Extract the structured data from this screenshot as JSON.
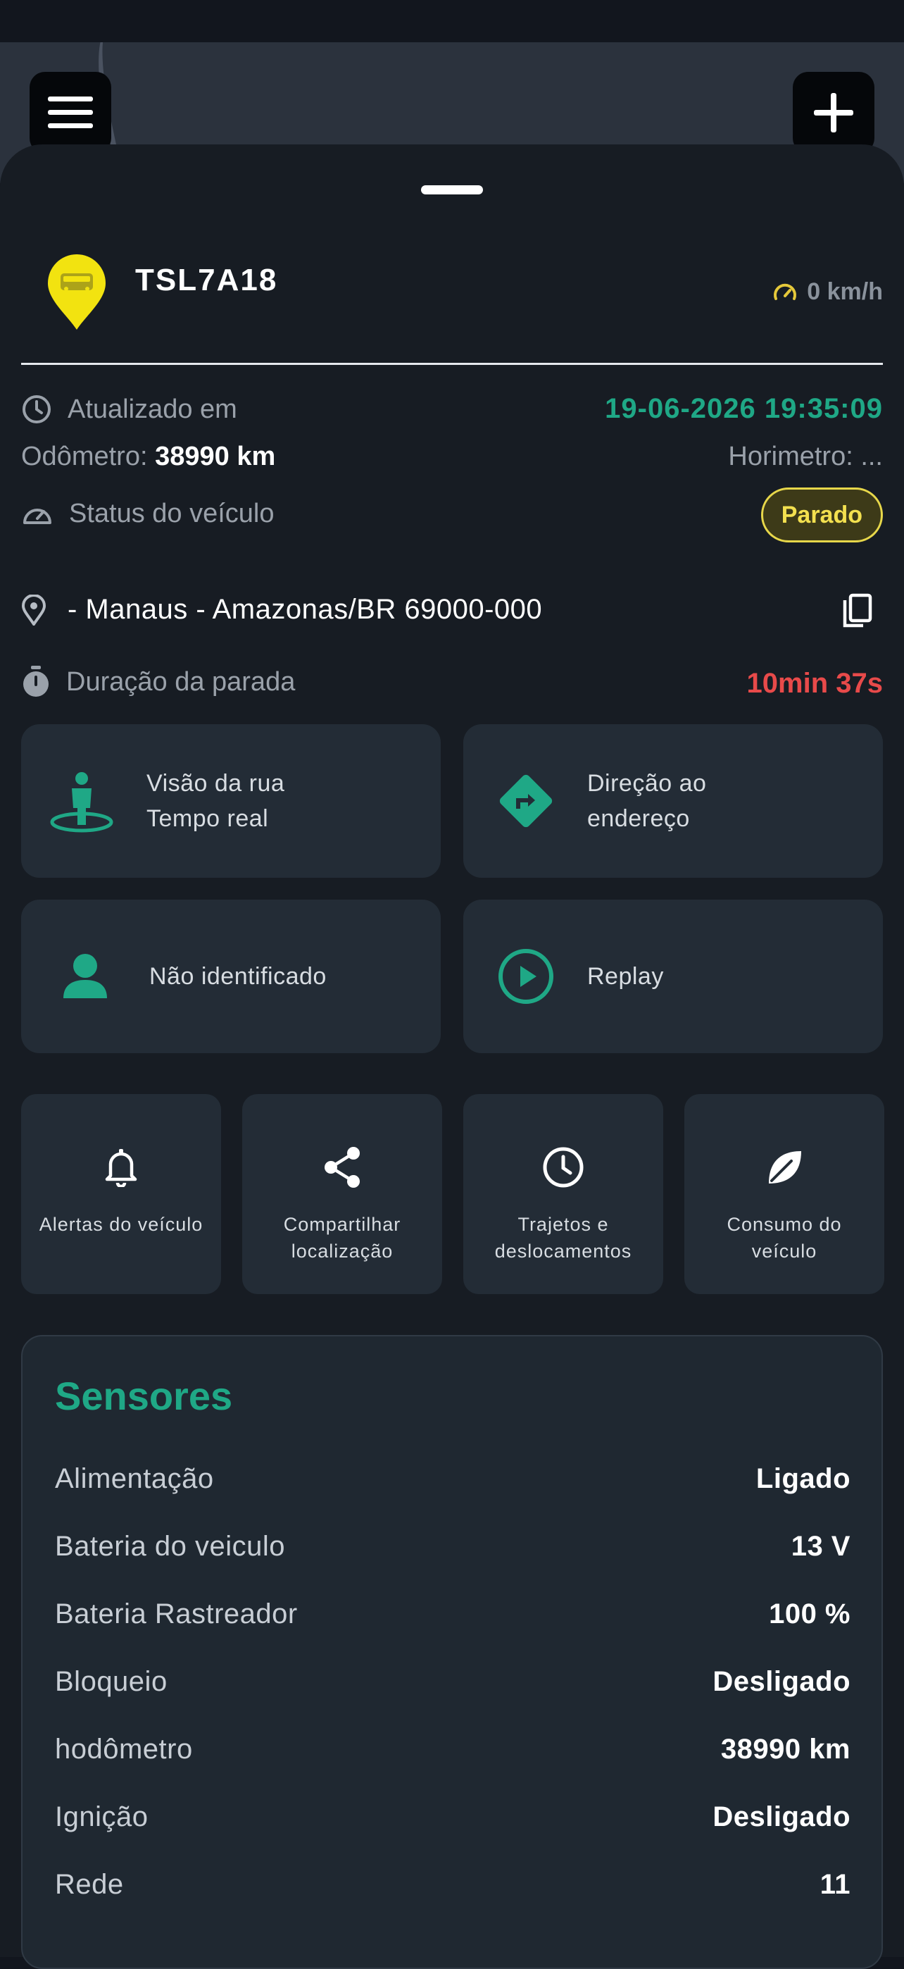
{
  "vehicle": {
    "plate": "TSL7A18",
    "speed": "0 km/h",
    "updated_label": "Atualizado em",
    "updated_value": "19-06-2026 19:35:09",
    "odometer_label": "Odômetro:",
    "odometer_value": "38990 km",
    "hourmeter_label": "Horimetro: ...",
    "status_label": "Status do veículo",
    "status_value": "Parado",
    "address": "- Manaus - Amazonas/BR 69000-000",
    "duration_label": "Duração da parada",
    "duration_value": "10min 37s"
  },
  "actions": {
    "street_view": {
      "line1": "Visão da rua",
      "line2": "Tempo real"
    },
    "directions": {
      "line1": "Direção ao",
      "line2": "endereço"
    },
    "driver": "Não identificado",
    "replay": "Replay"
  },
  "tiles": [
    {
      "label": "Alertas do veículo",
      "icon": "bell-icon"
    },
    {
      "label": "Compartilhar\nlocalização",
      "icon": "share-icon"
    },
    {
      "label": "Trajetos e\ndeslocamentos",
      "icon": "clock-icon"
    },
    {
      "label": "Consumo do\nveículo",
      "icon": "leaf-icon"
    }
  ],
  "sensors": {
    "title": "Sensores",
    "rows": [
      {
        "label": "Alimentação",
        "value": "Ligado"
      },
      {
        "label": "Bateria do veiculo",
        "value": "13 V"
      },
      {
        "label": "Bateria Rastreador",
        "value": "100 %"
      },
      {
        "label": "Bloqueio",
        "value": "Desligado"
      },
      {
        "label": "hodômetro",
        "value": "38990 km"
      },
      {
        "label": "Ignição",
        "value": "Desligado"
      },
      {
        "label": "Rede",
        "value": "11"
      }
    ]
  },
  "colors": {
    "accent": "#1fa886",
    "status_yellow": "#f3e04f",
    "alert_red": "#e84a4a",
    "card_bg": "#232c36"
  }
}
